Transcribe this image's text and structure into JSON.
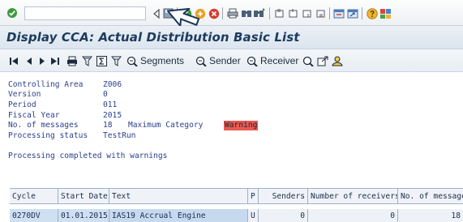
{
  "page": {
    "title": "Display CCA: Actual Distribution Basic List"
  },
  "system_toolbar": {
    "command_field_value": "",
    "icons": [
      "enter-icon",
      "back-arrow-icon",
      "save-icon",
      "back-icon",
      "exit-icon",
      "cancel-icon",
      "print-icon",
      "find-icon",
      "find-next-icon",
      "first-page-icon",
      "previous-page-icon",
      "next-page-icon",
      "last-page-icon",
      "new-session-icon",
      "shortcut-icon",
      "help-icon",
      "customize-layout-icon"
    ]
  },
  "app_toolbar": {
    "segments_label": "Segments",
    "sender_label": "Sender",
    "receiver_label": "Receiver"
  },
  "info": {
    "rows": [
      {
        "label": "Controlling Area",
        "value": "Z006"
      },
      {
        "label": "Version",
        "value": "0"
      },
      {
        "label": "Period",
        "value": "011"
      },
      {
        "label": "Fiscal Year",
        "value": "2015"
      },
      {
        "label": "No. of messages",
        "value": "18"
      },
      {
        "label": "Processing status",
        "value": "TestRun"
      }
    ],
    "max_category_label": "Maximum Category",
    "max_category_value": "Warning",
    "status_message": "Processing completed with warnings"
  },
  "table": {
    "columns": [
      "Cycle",
      "Start Date",
      "Text",
      "P",
      "Senders",
      "Number of receivers",
      "No. of message"
    ],
    "rows": [
      {
        "cycle": "0270DV",
        "start_date": "01.01.2015",
        "text": "IAS19 Accrual Engine",
        "p": "U",
        "senders": "0",
        "receivers": "0",
        "messages": "18"
      }
    ]
  },
  "colors": {
    "title_text": "#1d3b5c",
    "info_text": "#2b3f8c",
    "warning_bg": "#ea5b4f",
    "selected_row_bg": "#c6d9ef"
  }
}
